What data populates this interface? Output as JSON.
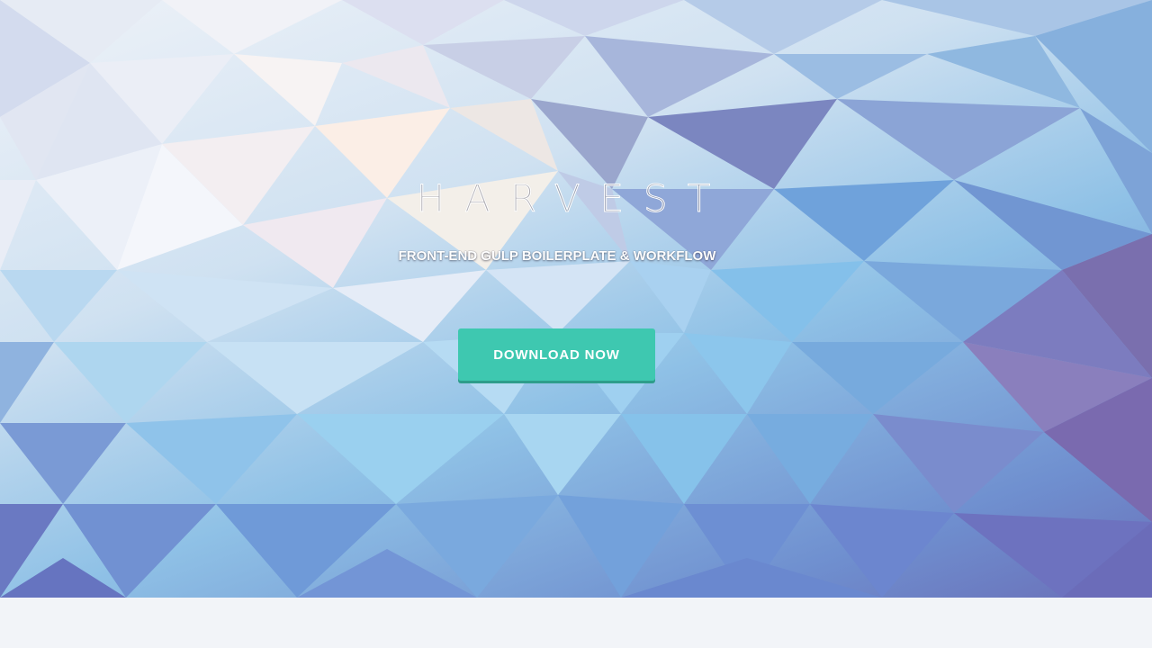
{
  "hero": {
    "logo_text": "HARVEST",
    "tagline": "FRONT-END GULP BOILERPLATE & WORKFLOW",
    "download_label": "DOWNLOAD NOW"
  },
  "colors": {
    "button": "#3ec8b0",
    "button_shadow": "#2e9d8b",
    "page_background": "#f2f4f8"
  }
}
